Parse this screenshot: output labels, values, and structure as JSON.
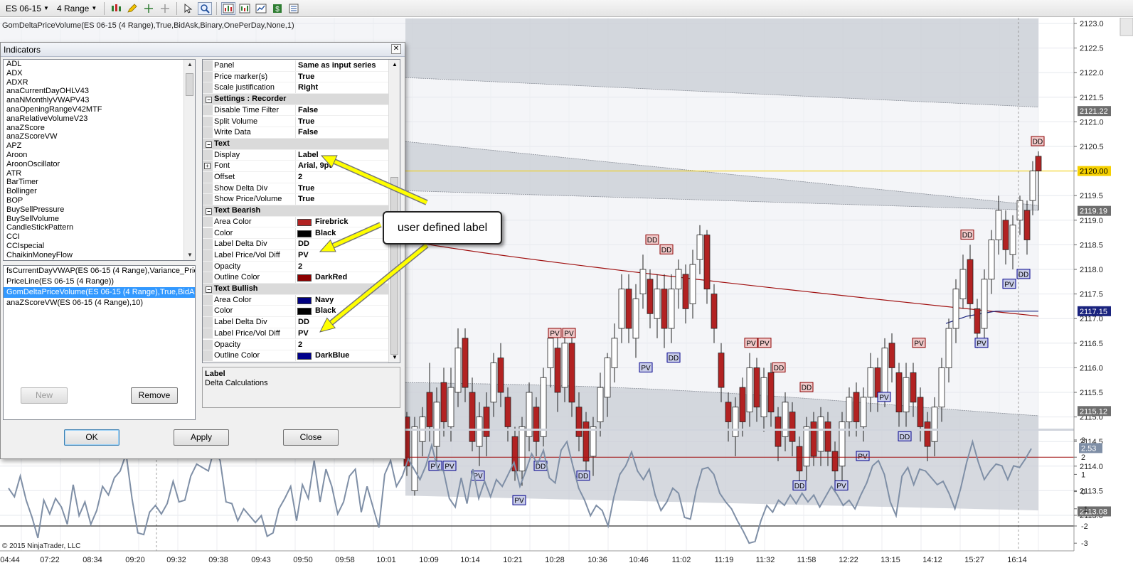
{
  "toolbar": {
    "instrument": "ES 06-15",
    "period": "4 Range",
    "icons": [
      "bar-style-icon",
      "drawing-pencil-icon",
      "crosshair-icon",
      "global-crosshair-icon",
      "cursor-icon",
      "zoom-icon",
      "indicators-icon",
      "strategies-icon",
      "chart-properties-icon",
      "data-box-icon",
      "properties-icon"
    ]
  },
  "chart": {
    "indicator_caption": "GomDeltaPriceVolume(ES 06-15 (4 Range),True,BidAsk,Binary,OnePerDay,None,1)",
    "copyright": "© 2015 NinjaTrader, LLC",
    "price_axis": {
      "ticks": [
        "2123.0",
        "2122.5",
        "2122.0",
        "2121.5",
        "2121.0",
        "2120.5",
        "2120.0",
        "2119.5",
        "2119.0",
        "2118.5",
        "2118.0",
        "2117.5",
        "2117.0",
        "2116.5",
        "2116.0",
        "2115.5",
        "2115.0",
        "2114.5",
        "2114.0",
        "2113.5",
        "2113.0"
      ],
      "markers": [
        {
          "label": "2121.22",
          "value": 2121.22,
          "color": "#6e6e6e"
        },
        {
          "label": "2120.00",
          "value": 2120.0,
          "color": "#f5d000"
        },
        {
          "label": "2119.19",
          "value": 2119.19,
          "color": "#6e6e6e"
        },
        {
          "label": "2117.15",
          "value": 2117.15,
          "color": "#1a237e"
        },
        {
          "label": "2115.12",
          "value": 2115.12,
          "color": "#6e6e6e"
        },
        {
          "label": "2113.08",
          "value": 2113.08,
          "color": "#6e6e6e"
        }
      ]
    },
    "osc_axis": {
      "ticks": [
        "3",
        "2",
        "1",
        "0",
        "-1",
        "-2",
        "-3"
      ],
      "marker": {
        "label": "2.53",
        "value": 2.53
      }
    },
    "time_axis": [
      "04:44",
      "07:22",
      "08:34",
      "09:20",
      "09:32",
      "09:38",
      "09:43",
      "09:50",
      "09:58",
      "10:01",
      "10:09",
      "10:14",
      "10:21",
      "10:28",
      "10:36",
      "10:46",
      "11:02",
      "11:19",
      "11:32",
      "11:58",
      "12:22",
      "13:15",
      "14:12",
      "15:27",
      "16:14"
    ],
    "labels": {
      "bearish": "DD",
      "price_vol": "PV"
    }
  },
  "callout": {
    "text": "user defined label"
  },
  "dialog": {
    "title": "Indicators",
    "indicator_list": [
      "ADL",
      "ADX",
      "ADXR",
      "anaCurrentDayOHLV43",
      "anaNMonthlyVWAPV43",
      "anaOpeningRangeV42MTF",
      "anaRelativeVolumeV23",
      "anaZScore",
      "anaZScoreVW",
      "APZ",
      "Aroon",
      "AroonOscillator",
      "ATR",
      "BarTimer",
      "Bollinger",
      "BOP",
      "BuySellPressure",
      "BuySellVolume",
      "CandleStickPattern",
      "CCI",
      "CCIspecial",
      "ChaikinMoneyFlow"
    ],
    "applied_list": [
      "fsCurrentDayVWAP(ES 06-15 (4 Range),Variance_Price,",
      "PriceLine(ES 06-15 (4 Range))",
      "GomDeltaPriceVolume(ES 06-15 (4 Range),True,BidAsk,",
      "anaZScoreVW(ES 06-15 (4 Range),10)"
    ],
    "buttons": {
      "new": "New",
      "remove": "Remove",
      "ok": "OK",
      "apply": "Apply",
      "close": "Close"
    },
    "description": {
      "title": "Label",
      "text": "Delta Calculations"
    },
    "properties": [
      {
        "kind": "prop",
        "name": "Panel",
        "value": "Same as input series"
      },
      {
        "kind": "prop",
        "name": "Price marker(s)",
        "value": "True"
      },
      {
        "kind": "prop",
        "name": "Scale justification",
        "value": "Right"
      },
      {
        "kind": "cat",
        "name": "Settings : Recorder"
      },
      {
        "kind": "prop",
        "name": "Disable Time Filter",
        "value": "False"
      },
      {
        "kind": "prop",
        "name": "Split Volume",
        "value": "True"
      },
      {
        "kind": "prop",
        "name": "Write Data",
        "value": "False"
      },
      {
        "kind": "cat",
        "name": "Text"
      },
      {
        "kind": "prop",
        "name": "Display",
        "value": "Label"
      },
      {
        "kind": "prop",
        "name": "Font",
        "value": "Arial, 9pt",
        "expander": true
      },
      {
        "kind": "prop",
        "name": "Offset",
        "value": "2"
      },
      {
        "kind": "prop",
        "name": "Show Delta Div",
        "value": "True"
      },
      {
        "kind": "prop",
        "name": "Show Price/Volume",
        "value": "True"
      },
      {
        "kind": "cat",
        "name": "Text Bearish"
      },
      {
        "kind": "prop",
        "name": "Area Color",
        "value": "Firebrick",
        "swatch": "#b22222"
      },
      {
        "kind": "prop",
        "name": "Color",
        "value": "Black",
        "swatch": "#000000"
      },
      {
        "kind": "prop",
        "name": "Label Delta Div",
        "value": "DD"
      },
      {
        "kind": "prop",
        "name": "Label Price/Vol Diff",
        "value": "PV"
      },
      {
        "kind": "prop",
        "name": "Opacity",
        "value": "2"
      },
      {
        "kind": "prop",
        "name": "Outline Color",
        "value": "DarkRed",
        "swatch": "#8b0000"
      },
      {
        "kind": "cat",
        "name": "Text Bullish"
      },
      {
        "kind": "prop",
        "name": "Area Color",
        "value": "Navy",
        "swatch": "#000080"
      },
      {
        "kind": "prop",
        "name": "Color",
        "value": "Black",
        "swatch": "#000000"
      },
      {
        "kind": "prop",
        "name": "Label Delta Div",
        "value": "DD"
      },
      {
        "kind": "prop",
        "name": "Label Price/Vol Diff",
        "value": "PV"
      },
      {
        "kind": "prop",
        "name": "Opacity",
        "value": "2"
      },
      {
        "kind": "prop",
        "name": "Outline Color",
        "value": "DarkBlue",
        "swatch": "#00008b"
      }
    ]
  },
  "colors": {
    "up_candle": "#ffffff",
    "down_candle": "#b22222",
    "band_fill": "#c8ccd4",
    "vwap_line": "#a01010",
    "zscore_line": "#1a237e",
    "osc_line": "#7f8fa6",
    "price_line": "#f5d000",
    "arrow": "#ffff00"
  }
}
